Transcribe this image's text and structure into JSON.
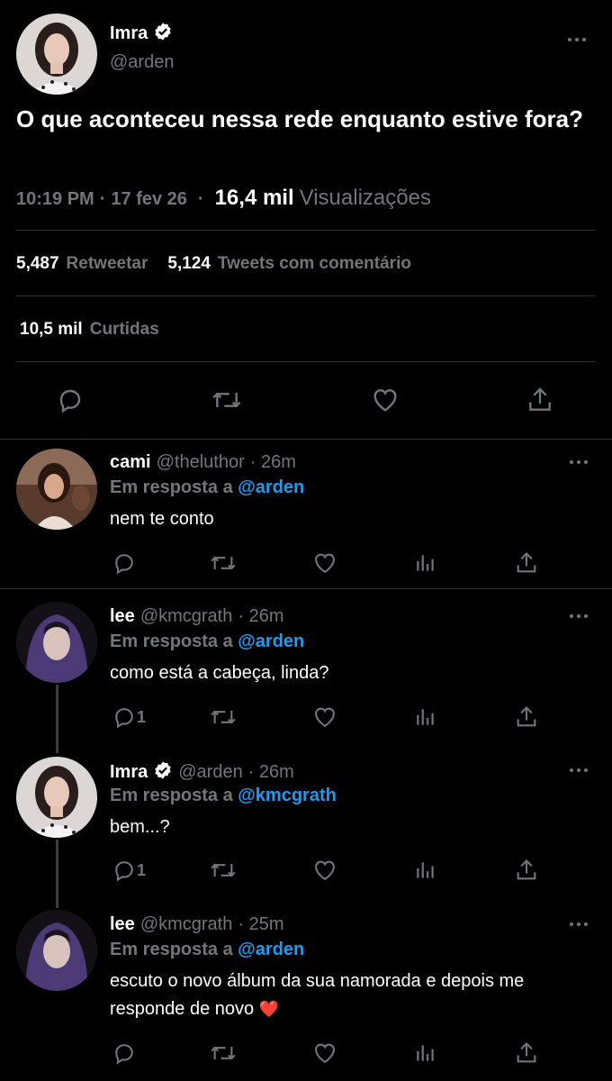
{
  "main_tweet": {
    "author_name": "Imra",
    "author_handle": "@arden",
    "text": "O que aconteceu nessa rede enquanto estive fora?",
    "time": "10:19 PM",
    "sep1": "·",
    "date": "17 fev 26",
    "sep2": "·",
    "views_count": "16,4 mil",
    "views_label": "Visualizações",
    "retweets_count": "5,487",
    "retweets_label": "Retweetar",
    "quotes_count": "5,124",
    "quotes_label": "Tweets com comentário",
    "likes_count": "10,5 mil",
    "likes_label": "Curtidas"
  },
  "replies": [
    {
      "name": "cami",
      "handle": "@theluthor",
      "time": "· 26m",
      "reply_prefix": "Em resposta a",
      "reply_to": "@arden",
      "text": "nem te conto",
      "reply_count": ""
    },
    {
      "name": "lee",
      "handle": "@kmcgrath",
      "time": "· 26m",
      "reply_prefix": "Em resposta a",
      "reply_to": "@arden",
      "text": "como está a cabeça, linda?",
      "reply_count": "1"
    },
    {
      "name": "Imra",
      "handle": "@arden",
      "time": "· 26m",
      "reply_prefix": "Em resposta a",
      "reply_to": "@kmcgrath",
      "text": "bem...?",
      "reply_count": "1"
    },
    {
      "name": "lee",
      "handle": "@kmcgrath",
      "time": "· 25m",
      "reply_prefix": "Em resposta a",
      "reply_to": "@arden",
      "text_line1": "escuto o novo álbum da sua namorada e depois me",
      "text_line2": "responde de novo",
      "emoji": "❤️",
      "reply_count": ""
    }
  ],
  "colors": {
    "background": "#000000",
    "text": "#e7e9ea",
    "muted": "#71767b",
    "accent": "#1d9bf0",
    "divider": "#2f3336"
  },
  "icons": [
    "reply-icon",
    "retweet-icon",
    "like-icon",
    "share-icon",
    "analytics-icon",
    "more-icon",
    "verified-icon"
  ]
}
